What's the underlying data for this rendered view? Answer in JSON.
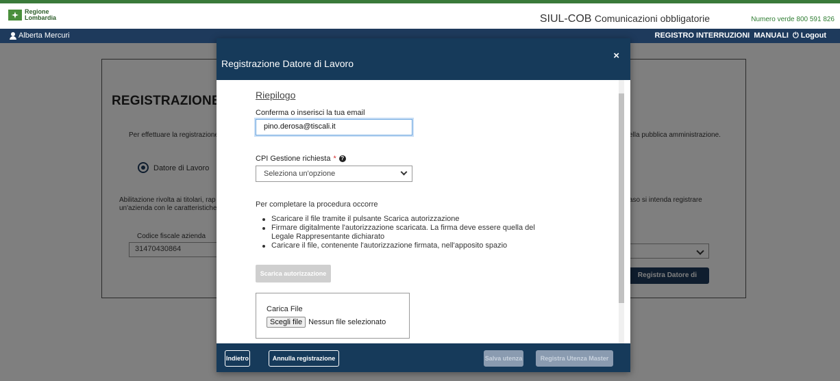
{
  "header": {
    "logo_line1": "Regione",
    "logo_line2": "Lombardia",
    "app_title": "SIUL-COB",
    "app_subtitle": "Comunicazioni obbligatorie",
    "verde": "Numero verde 800 591 826"
  },
  "navbar": {
    "user": "Alberta Mercuri",
    "links": [
      "REGISTRO INTERRUZIONI",
      "MANUALI",
      "Logout"
    ]
  },
  "background": {
    "title": "REGISTRAZIONE UTEN",
    "intro": "Per effettuare la registrazione d",
    "intro_right": "ella pubblica amministrazione.",
    "radio_label": "Datore di Lavoro",
    "abil_line1": "Abilitazione rivolta ai titolari, rap",
    "abil_line2": "un'azienda con le caratteristiche",
    "abil_right": "aso si intenda registrare",
    "cf_label": "Codice fiscale azienda",
    "cf_value": "31470430864",
    "register_button": "Registra Datore di Lavoro"
  },
  "modal": {
    "title": "Registrazione Datore di Lavoro",
    "close": "×",
    "riepilogo": "Riepilogo",
    "email_label": "Conferma o inserisci la tua email",
    "email_value": "pino.derosa@tiscali.it",
    "cpi_label": "CPI Gestione richiesta",
    "cpi_required": "*",
    "cpi_placeholder": "Seleziona un'opzione",
    "procedure_intro": "Per completare la procedura occorre",
    "steps": [
      "Scaricare il file tramite il pulsante Scarica autorizzazione",
      "Firmare digitalmente l'autorizzazione scaricata. La firma deve essere quella del Legale Rappresentante dichiarato",
      "Caricare il file, contenente l'autorizzazione firmata, nell'apposito spazio"
    ],
    "download_button": "Scarica autorizzazione",
    "upload_label": "Carica File",
    "choose_file": "Scegli file",
    "no_file": "Nessun file selezionato",
    "footer": {
      "back": "Indietro",
      "cancel": "Annulla registrazione",
      "save_user": "Salva utenza",
      "register_master": "Registra Utenza Master"
    }
  }
}
